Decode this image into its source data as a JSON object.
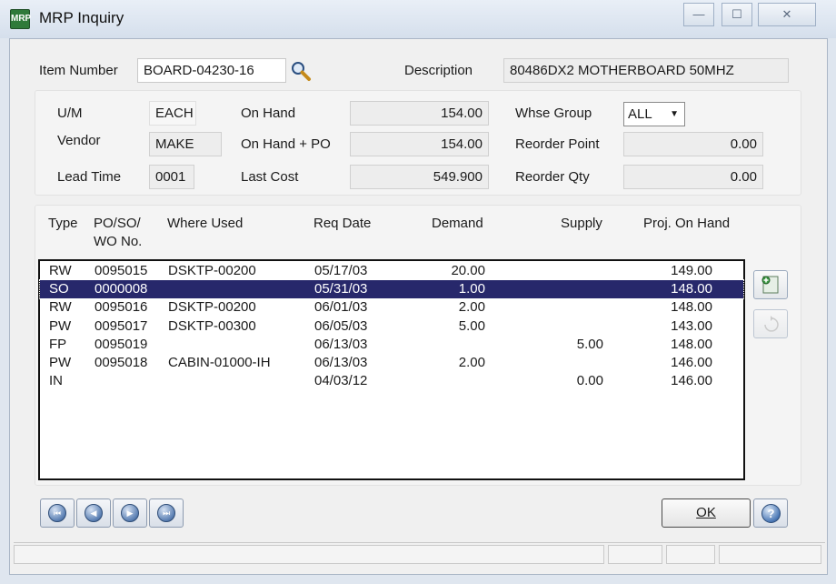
{
  "window": {
    "title": "MRP Inquiry",
    "icon_text": "MRP",
    "minimize_glyph": "—",
    "maximize_glyph": "☐",
    "close_glyph": "✕"
  },
  "item": {
    "item_number_label": "Item Number",
    "item_number_value": "BOARD-04230-16",
    "description_label": "Description",
    "description_value": "80486DX2 MOTHERBOARD 50MHZ"
  },
  "info": {
    "um_label": "U/M",
    "um_value": "EACH",
    "vendor_label": "Vendor",
    "vendor_value": "MAKE",
    "lead_time_label": "Lead Time",
    "lead_time_value": "0001",
    "on_hand_label": "On Hand",
    "on_hand_value": "154.00",
    "on_hand_po_label": "On Hand + PO",
    "on_hand_po_value": "154.00",
    "last_cost_label": "Last Cost",
    "last_cost_value": "549.900",
    "whse_group_label": "Whse Group",
    "whse_group_value": "ALL",
    "reorder_point_label": "Reorder Point",
    "reorder_point_value": "0.00",
    "reorder_qty_label": "Reorder Qty",
    "reorder_qty_value": "0.00"
  },
  "grid": {
    "headers": {
      "type": "Type",
      "po_line1": "PO/SO/",
      "po_line2": "WO No.",
      "where_used": "Where Used",
      "req_date": "Req Date",
      "demand": "Demand",
      "supply": "Supply",
      "proj_on_hand": "Proj. On Hand"
    },
    "rows": [
      {
        "type": "RW",
        "order": "0095015",
        "where_used": "DSKTP-00200",
        "req_date": "05/17/03",
        "demand": "20.00",
        "supply": "",
        "proj": "149.00"
      },
      {
        "type": "SO",
        "order": "0000008",
        "where_used": "",
        "req_date": "05/31/03",
        "demand": "1.00",
        "supply": "",
        "proj": "148.00"
      },
      {
        "type": "RW",
        "order": "0095016",
        "where_used": "DSKTP-00200",
        "req_date": "06/01/03",
        "demand": "2.00",
        "supply": "",
        "proj": "148.00"
      },
      {
        "type": "PW",
        "order": "0095017",
        "where_used": "DSKTP-00300",
        "req_date": "06/05/03",
        "demand": "5.00",
        "supply": "",
        "proj": "143.00"
      },
      {
        "type": "FP",
        "order": "0095019",
        "where_used": "",
        "req_date": "06/13/03",
        "demand": "",
        "supply": "5.00",
        "proj": "148.00"
      },
      {
        "type": "PW",
        "order": "0095018",
        "where_used": "CABIN-01000-IH",
        "req_date": "06/13/03",
        "demand": "2.00",
        "supply": "",
        "proj": "146.00"
      },
      {
        "type": "IN",
        "order": "",
        "where_used": "",
        "req_date": "04/03/12",
        "demand": "",
        "supply": "0.00",
        "proj": "146.00"
      }
    ],
    "selected_row": 1
  },
  "buttons": {
    "ok_label": "OK",
    "help_glyph": "?",
    "first_glyph": "⏮",
    "prev_glyph": "◀",
    "next_glyph": "▶",
    "last_glyph": "⏭"
  }
}
